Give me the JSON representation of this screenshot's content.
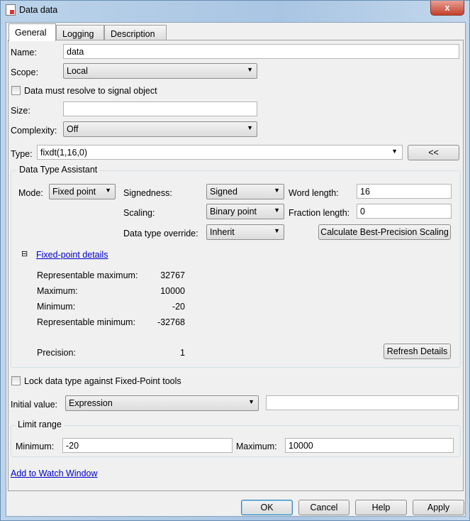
{
  "window": {
    "title": "Data data",
    "close": "x"
  },
  "tabs": [
    "General",
    "Logging",
    "Description"
  ],
  "general": {
    "name_label": "Name:",
    "name_value": "data",
    "scope_label": "Scope:",
    "scope_value": "Local",
    "resolve_label": "Data must resolve to signal object",
    "resolve_checked": false,
    "size_label": "Size:",
    "size_value": "",
    "complexity_label": "Complexity:",
    "complexity_value": "Off",
    "type_label": "Type:",
    "type_value": "fixdt(1,16,0)",
    "type_toggle": "<<",
    "dta": {
      "title": "Data Type Assistant",
      "mode_label": "Mode:",
      "mode_value": "Fixed point",
      "signedness_label": "Signedness:",
      "signedness_value": "Signed",
      "word_length_label": "Word length:",
      "word_length_value": "16",
      "scaling_label": "Scaling:",
      "scaling_value": "Binary point",
      "fraction_length_label": "Fraction length:",
      "fraction_length_value": "0",
      "override_label": "Data type override:",
      "override_value": "Inherit",
      "calc_button": "Calculate Best-Precision Scaling",
      "details_toggle": "⊟",
      "details_link": "Fixed-point details",
      "details": [
        {
          "label": "Representable maximum:",
          "value": "32767"
        },
        {
          "label": "Maximum:",
          "value": "10000"
        },
        {
          "label": "Minimum:",
          "value": "-20"
        },
        {
          "label": "Representable minimum:",
          "value": "-32768"
        }
      ],
      "precision_label": "Precision:",
      "precision_value": "1",
      "refresh_button": "Refresh Details"
    },
    "lock_label": "Lock data type against Fixed-Point tools",
    "lock_checked": false,
    "initial_label": "Initial value:",
    "initial_mode": "Expression",
    "initial_value": "",
    "limit": {
      "title": "Limit range",
      "min_label": "Minimum:",
      "min_value": "-20",
      "max_label": "Maximum:",
      "max_value": "10000"
    },
    "watch_link": "Add to Watch Window"
  },
  "buttons": {
    "ok": "OK",
    "cancel": "Cancel",
    "help": "Help",
    "apply": "Apply"
  }
}
